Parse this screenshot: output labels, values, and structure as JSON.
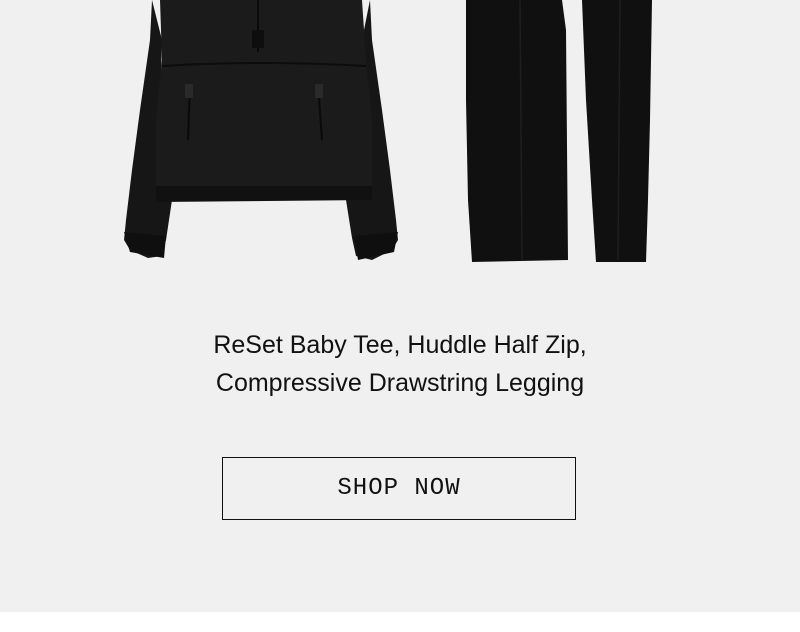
{
  "product": {
    "caption_line1": "ReSet Baby Tee, Huddle Half Zip,",
    "caption_line2": "Compressive Drawstring Legging",
    "image_items": [
      "half-zip-jacket",
      "drawstring-legging"
    ]
  },
  "cta": {
    "label": "SHOP NOW"
  },
  "colors": {
    "background": "#f0f0f0",
    "garment": "#151515",
    "text": "#111111"
  }
}
